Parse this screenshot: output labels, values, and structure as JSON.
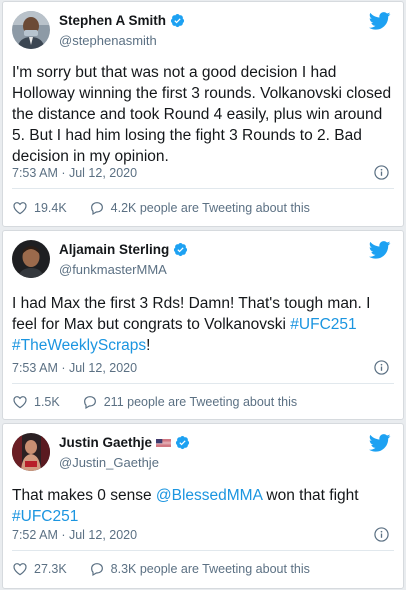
{
  "colors": {
    "link": "#1b95e0",
    "twitter_blue": "#1da1f2",
    "verified": "#1da1f2",
    "muted": "#5b7083"
  },
  "tweets": [
    {
      "name": "Stephen A Smith",
      "handle": "@stephenasmith",
      "verified": true,
      "text": "I'm sorry but that was not a good decision I had Holloway winning the first 3 rounds. Volkanovski closed the distance and took Round 4 easily, plus win around 5. But I had him losing the fight 3 Rounds to 2. Bad decision in my opinion.",
      "timestamp": "7:53 AM · Jul 12, 2020",
      "likes": "19.4K",
      "replies": "4.2K people are Tweeting about this"
    },
    {
      "name": "Aljamain Sterling",
      "handle": "@funkmasterMMA",
      "verified": true,
      "text_plain": "I had Max the first 3 Rds! Damn! That's tough man. I feel for Max but congrats to Volkanovski",
      "hashtag1": "#UFC251",
      "hashtag2": "#TheWeeklyScraps",
      "text_end": "!",
      "timestamp": "7:53 AM · Jul 12, 2020",
      "likes": "1.5K",
      "replies": "211 people are Tweeting about this"
    },
    {
      "name": "Justin Gaethje",
      "flag": "us-flag",
      "handle": "@Justin_Gaethje",
      "verified": true,
      "text_plain": "That makes 0 sense",
      "mention": "@BlessedMMA",
      "text_mid": "won that fight",
      "hashtag1": "#UFC251",
      "timestamp": "7:52 AM · Jul 12, 2020",
      "likes": "27.3K",
      "replies": "8.3K people are Tweeting about this"
    }
  ]
}
